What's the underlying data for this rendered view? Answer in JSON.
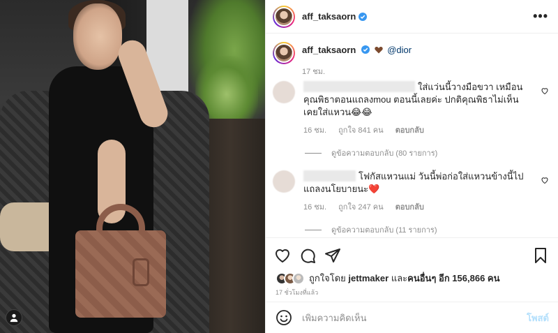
{
  "post": {
    "username": "aff_taksaorn",
    "more_icon": "more-horizontal-icon"
  },
  "caption": {
    "username": "aff_taksaorn",
    "mention": "@dior",
    "time": "17 ชม."
  },
  "comments": [
    {
      "text": "ใส่แว่นนี้วางมือขวา เหมือนคุณพิธาตอนแถลงmou ตอนนี้เลยค่ะ ปกติคุณพิธาไม่เห็นเคยใส่แหวน😂😂",
      "time": "16 ชม.",
      "likes": "ถูกใจ 841 คน",
      "reply": "ตอบกลับ",
      "view_replies": "ดูข้อความตอบกลับ (80 รายการ)"
    },
    {
      "text": "โฟกัสแหวนแม่ วันนี้พ่อก่อใส่แหวนข้างนี้ไปแถลงนโยบายนะ❤️",
      "time": "16 ชม.",
      "likes": "ถูกใจ 247 คน",
      "reply": "ตอบกลับ",
      "view_replies": "ดูข้อความตอบกลับ (11 รายการ)"
    }
  ],
  "likes": {
    "prefix": "ถูกใจโดย",
    "user": "jettmaker",
    "middle": "และ",
    "others": "คนอื่นๆ อีก 156,866 คน"
  },
  "posted_ago": "17 ชั่วโมงที่แล้ว",
  "add_comment": {
    "placeholder": "เพิ่มความคิดเห็น",
    "post_label": "โพสต์"
  },
  "colors": {
    "verified": "#3897f0",
    "link": "#00376b",
    "muted": "#8e8e8e",
    "post_disabled": "#b2dffc"
  }
}
